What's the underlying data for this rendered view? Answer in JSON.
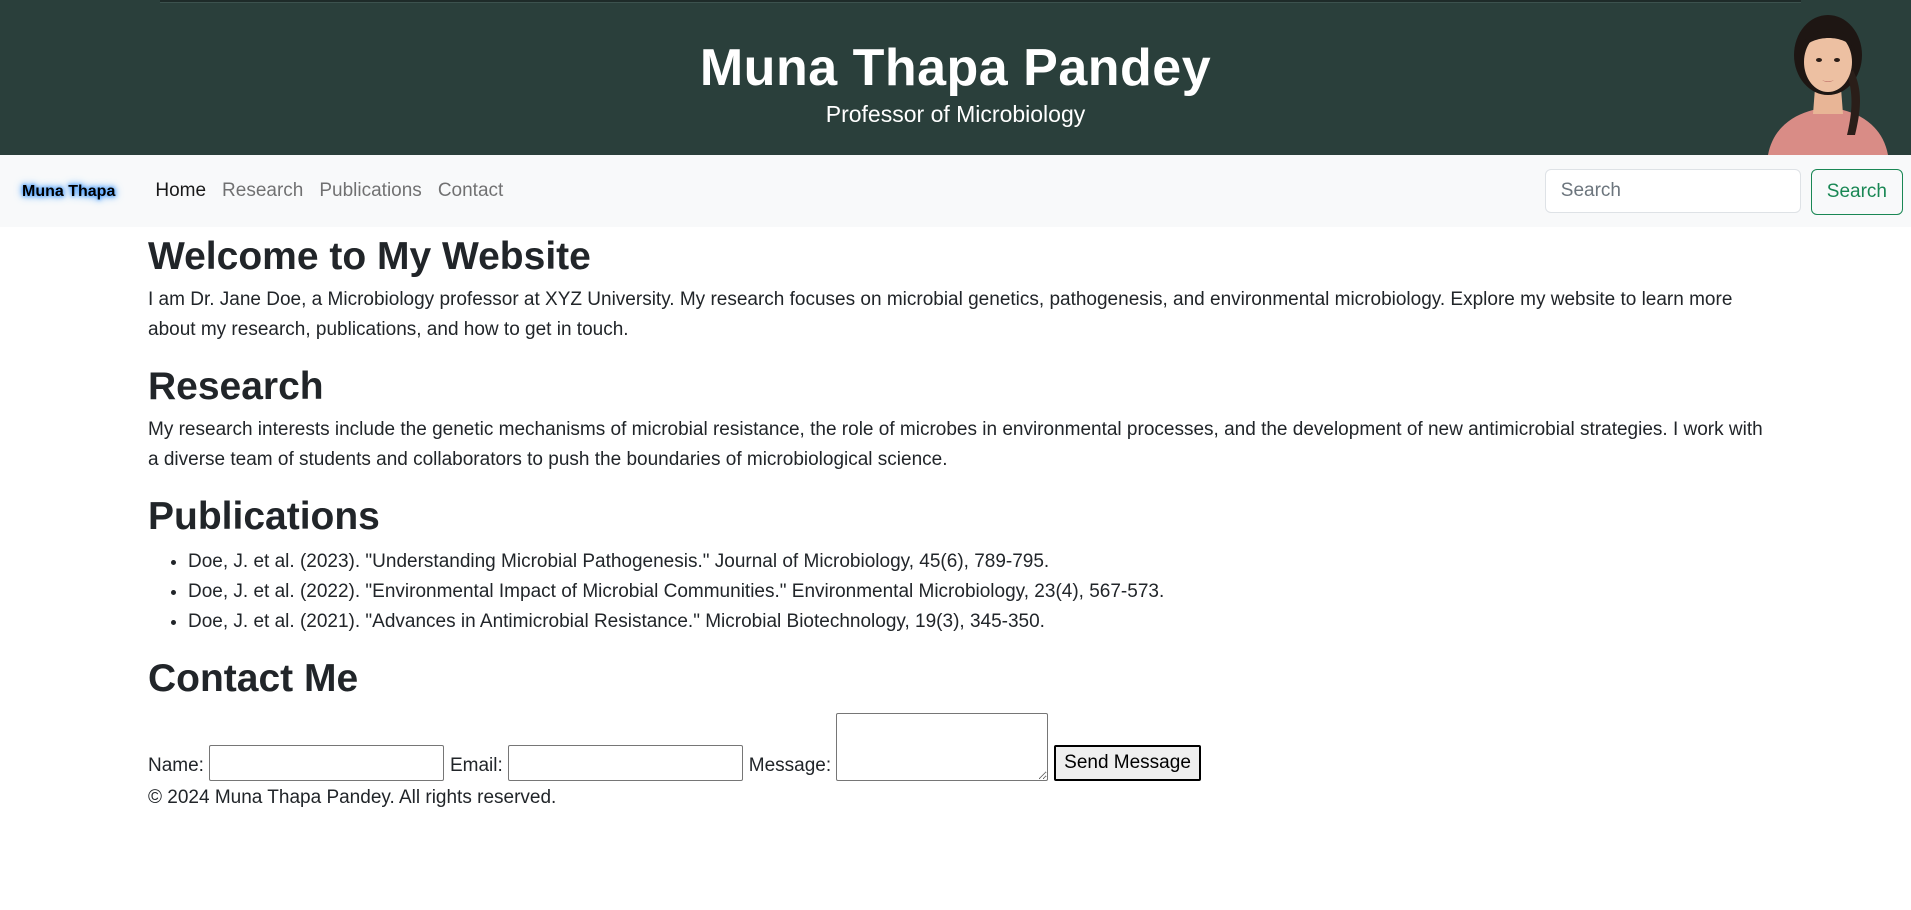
{
  "header": {
    "name": "Muna Thapa Pandey",
    "title": "Professor of Microbiology"
  },
  "navbar": {
    "brand": "Muna Thapa",
    "links": [
      {
        "label": "Home",
        "active": true
      },
      {
        "label": "Research",
        "active": false
      },
      {
        "label": "Publications",
        "active": false
      },
      {
        "label": "Contact",
        "active": false
      }
    ],
    "search": {
      "placeholder": "Search",
      "button_label": "Search"
    }
  },
  "welcome": {
    "heading": "Welcome to My Website",
    "text": "I am Dr. Jane Doe, a Microbiology professor at XYZ University. My research focuses on microbial genetics, pathogenesis, and environmental microbiology. Explore my website to learn more about my research, publications, and how to get in touch."
  },
  "research": {
    "heading": "Research",
    "text": "My research interests include the genetic mechanisms of microbial resistance, the role of microbes in environmental processes, and the development of new antimicrobial strategies. I work with a diverse team of students and collaborators to push the boundaries of microbiological science."
  },
  "publications": {
    "heading": "Publications",
    "items": [
      "Doe, J. et al. (2023). \"Understanding Microbial Pathogenesis.\" Journal of Microbiology, 45(6), 789-795.",
      "Doe, J. et al. (2022). \"Environmental Impact of Microbial Communities.\" Environmental Microbiology, 23(4), 567-573.",
      "Doe, J. et al. (2021). \"Advances in Antimicrobial Resistance.\" Microbial Biotechnology, 19(3), 345-350."
    ]
  },
  "contact": {
    "heading": "Contact Me",
    "name_label": "Name:",
    "name_value": "",
    "email_label": "Email:",
    "email_value": "",
    "message_label": "Message:",
    "message_value": "",
    "submit_label": "Send Message"
  },
  "footer": {
    "text": "© 2024 Muna Thapa Pandey. All rights reserved."
  },
  "colors": {
    "header_bg": "#2a3f3b",
    "navbar_bg": "#f8f9fa",
    "search_button": "#198754"
  }
}
